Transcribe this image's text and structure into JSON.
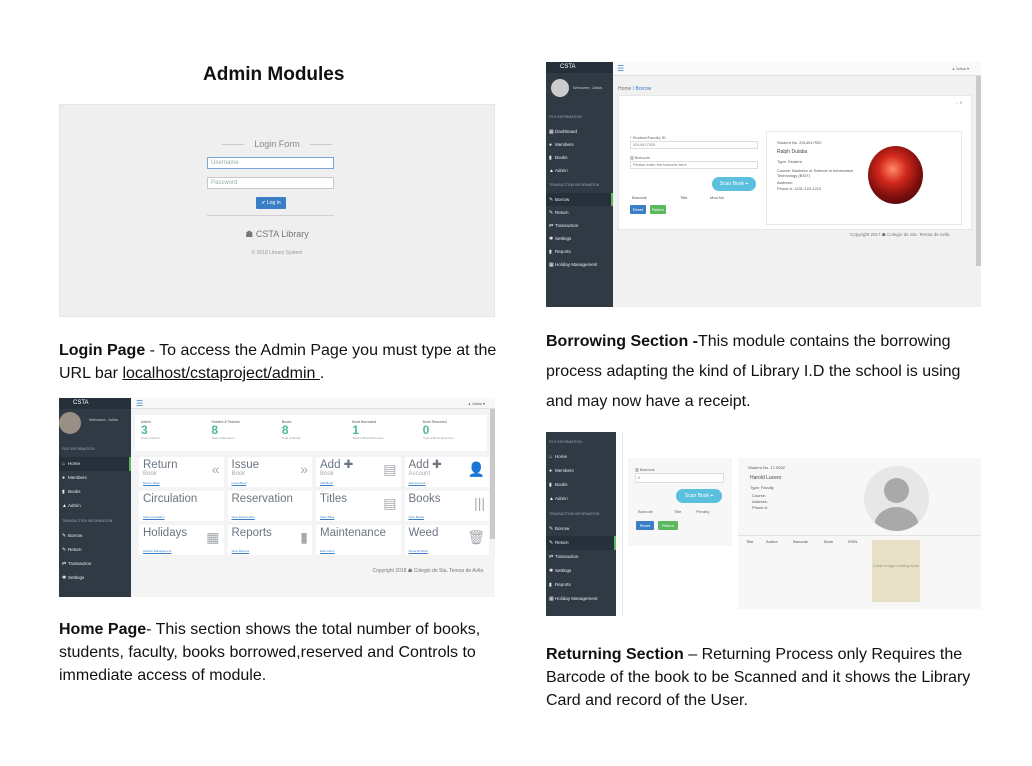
{
  "heading": "Admin Modules",
  "captions": {
    "login": {
      "title": "Login Page",
      "text1": " - To access the Admin Page you must type at the URL bar ",
      "url": "localhost/cstaproject/admin ",
      "text2": "."
    },
    "home": {
      "title": "Home Page",
      "text": "- This section shows the total number of books, students, faculty, books borrowed,reserved and Controls to immediate access of module."
    },
    "borrow": {
      "title": "Borrowing Section -",
      "text": "This module contains the borrowing process adapting the kind of Library I.D the school is using and may now have a receipt."
    },
    "return": {
      "title": "Returning Section",
      "text": " – Returning Process only Requires the  Barcode of the book to be Scanned and it shows the Library Card and record of the User."
    }
  },
  "login_mock": {
    "form_title": "Login Form",
    "username_placeholder": "Username",
    "password_placeholder": "Password",
    "button": "Log in",
    "brand": "CSTA Library",
    "copyright": "© 2018 Library System"
  },
  "dashboard_mock": {
    "brand": "CSTA",
    "user": "Jollus",
    "welcome": "Welcome, Jollus",
    "section_file": "FILE INFORMATION",
    "section_transaction": "TRANSACTION INFORMATION",
    "nav_file": [
      "Home",
      "Members",
      "Books",
      "Admin"
    ],
    "nav_transaction": [
      "Borrow",
      "Return",
      "Transaction",
      "Settings"
    ],
    "stats": [
      {
        "label": "Admin",
        "value": "3",
        "footer": "Total of Admin"
      },
      {
        "label": "Student & Teacher",
        "value": "8",
        "footer": "Total of Members"
      },
      {
        "label": "Books",
        "value": "8",
        "footer": "Total of Books"
      },
      {
        "label": "Book Borrowed",
        "value": "1",
        "footer": "Total of Book Borrowed"
      },
      {
        "label": "Book Reserved",
        "value": "0",
        "footer": "Total of Book Reserved"
      }
    ],
    "tiles": [
      {
        "title": "Return",
        "sub": "Book",
        "link": "Return Book",
        "icon": "«"
      },
      {
        "title": "Issue",
        "sub": "Book",
        "link": "Issue Book",
        "icon": "»"
      },
      {
        "title": "Add ✚",
        "sub": "Book",
        "link": "Add Book",
        "icon": "▤"
      },
      {
        "title": "Add ✚",
        "sub": "Account",
        "link": "Add Account",
        "icon": "👤"
      },
      {
        "title": "Circulation",
        "sub": "",
        "link": "View Circulation",
        "icon": ""
      },
      {
        "title": "Reservation",
        "sub": "",
        "link": "View Reservation",
        "icon": ""
      },
      {
        "title": "Titles",
        "sub": "",
        "link": "View Titles",
        "icon": "▤"
      },
      {
        "title": "Books",
        "sub": "",
        "link": "View Books",
        "icon": "|||"
      },
      {
        "title": "Holidays",
        "sub": "",
        "link": "Holiday Management",
        "icon": "▦"
      },
      {
        "title": "Reports",
        "sub": "",
        "link": "View Reports",
        "icon": "▮"
      },
      {
        "title": "Maintenance",
        "sub": "",
        "link": "Edit Author",
        "icon": ""
      },
      {
        "title": "Weed",
        "sub": "",
        "link": "Weed Rubbish",
        "icon": "🗑"
      }
    ],
    "footer": "Copyright 2018 ☗ Colegio de Sta. Teresa de Avila"
  },
  "borrow_mock": {
    "brand": "CSTA",
    "welcome": "Welcome, Jollus",
    "user": "Jollus",
    "section_file": "FILE INFORMATION",
    "section_transaction": "TRANSACTION INFORMATION",
    "nav_file": [
      "Dashboard",
      "Members",
      "Books",
      "Admin"
    ],
    "nav_transaction": [
      "Borrow",
      "Return",
      "Transaction",
      "Settings",
      "Reports",
      "Holiday Management"
    ],
    "breadcrumb_home": "Home",
    "breadcrumb_current": "Borrow",
    "id_label": "* Student/Faculty ID",
    "id_value": "2014017920",
    "barcode_label": "Barcode",
    "barcode_placeholder": "Please enter the barcode here",
    "scan_button": "Scan Book",
    "col_barcode": "Barcode",
    "col_title": "Title",
    "col_mod": "Mod No",
    "reset_button": "Reset",
    "return_button": "Return",
    "card_id": "Student No. 2014017920",
    "card_name": "Ralph Dulaba",
    "card_type": "Type: Student",
    "card_course": "Course: Bachelor of Science in Information Technology (BSIT)",
    "card_address": "Address:",
    "card_phone": "Phone #: 1231-123-1212",
    "footer": "Copyright 2017 ☗ Colegio de Sta. Teresa de Avila"
  },
  "return_mock": {
    "section_file": "FILE INFORMATION",
    "section_transaction": "TRANSACTION INFORMATION",
    "nav_file": [
      "Home",
      "Members",
      "Books",
      "Admin"
    ],
    "nav_transaction": [
      "Borrow",
      "Return",
      "Transaction",
      "Settings",
      "Reports",
      "Holiday Management"
    ],
    "barcode_label": "Barcode",
    "barcode_value": "0",
    "scan_button": "Scan Book",
    "col_barcode": "Barcode",
    "col_title": "Title",
    "col_penalty": "Penalty",
    "reset_button": "Reset",
    "return_button": "Return",
    "card_id": "Student No. 17-0002",
    "card_name": "Harold Lucero",
    "card_type": "Type: Faculty",
    "card_course": "Course:",
    "card_address": "Address:",
    "card_phone": "Phone #:",
    "history_cols": [
      "Title",
      "Author",
      "Barcode",
      "Book",
      "ISSN"
    ],
    "cover_text": "Cover image coming soon"
  },
  "colors": {
    "accent": "#3b7ec8",
    "sidebar": "#2f3a45",
    "stat": "#4fb89a",
    "scan": "#5bc0de",
    "success": "#5cb85c"
  }
}
